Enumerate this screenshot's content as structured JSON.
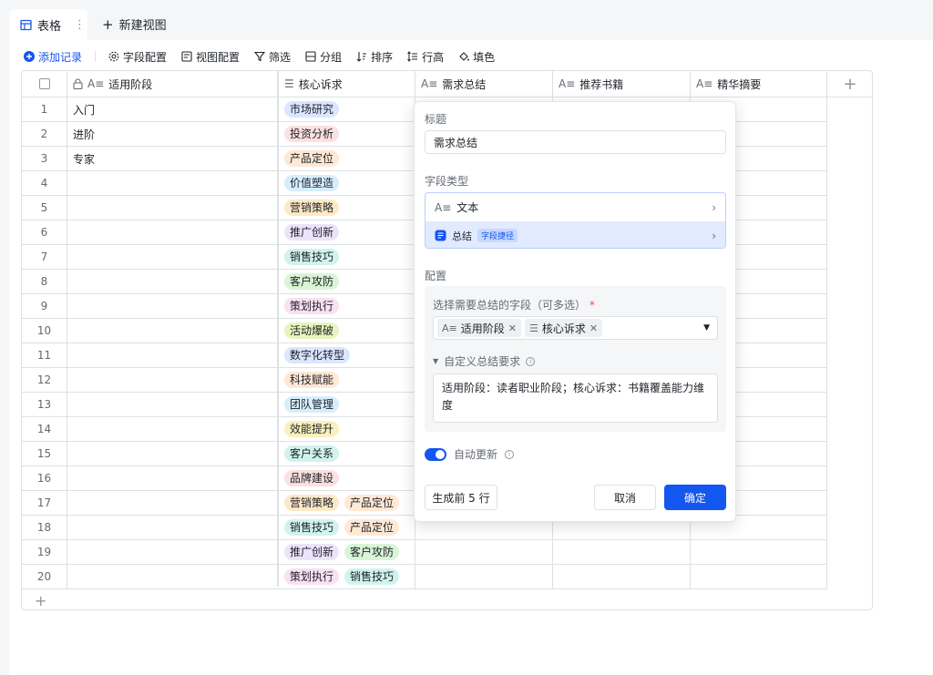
{
  "tabs": {
    "active": "表格",
    "new_view": "新建视图"
  },
  "toolbar": {
    "add_record": "添加记录",
    "field_config": "字段配置",
    "view_config": "视图配置",
    "filter": "筛选",
    "group": "分组",
    "sort": "排序",
    "row_height": "行高",
    "fill": "填色"
  },
  "columns": [
    "适用阶段",
    "核心诉求",
    "需求总结",
    "推荐书籍",
    "精华摘要"
  ],
  "rows": [
    {
      "n": "1",
      "stage": "入门",
      "tags": [
        {
          "t": "市场研究",
          "c": "#dbe6ff"
        }
      ]
    },
    {
      "n": "2",
      "stage": "进阶",
      "tags": [
        {
          "t": "投资分析",
          "c": "#fde0e0"
        }
      ]
    },
    {
      "n": "3",
      "stage": "专家",
      "tags": [
        {
          "t": "产品定位",
          "c": "#ffe8d4"
        }
      ]
    },
    {
      "n": "4",
      "stage": "",
      "tags": [
        {
          "t": "价值塑造",
          "c": "#d6eefc"
        }
      ]
    },
    {
      "n": "5",
      "stage": "",
      "tags": [
        {
          "t": "营销策略",
          "c": "#fde9c8"
        }
      ]
    },
    {
      "n": "6",
      "stage": "",
      "tags": [
        {
          "t": "推广创新",
          "c": "#ece3fb"
        }
      ]
    },
    {
      "n": "7",
      "stage": "",
      "tags": [
        {
          "t": "销售技巧",
          "c": "#d1f3ec"
        }
      ]
    },
    {
      "n": "8",
      "stage": "",
      "tags": [
        {
          "t": "客户攻防",
          "c": "#d9f5d6"
        }
      ]
    },
    {
      "n": "9",
      "stage": "",
      "tags": [
        {
          "t": "策划执行",
          "c": "#f9e0f2"
        }
      ]
    },
    {
      "n": "10",
      "stage": "",
      "tags": [
        {
          "t": "活动爆破",
          "c": "#e8f5bd"
        }
      ]
    },
    {
      "n": "11",
      "stage": "",
      "tags": [
        {
          "t": "数字化转型",
          "c": "#dbe6ff"
        }
      ]
    },
    {
      "n": "12",
      "stage": "",
      "tags": [
        {
          "t": "科技赋能",
          "c": "#ffe8d4"
        }
      ]
    },
    {
      "n": "13",
      "stage": "",
      "tags": [
        {
          "t": "团队管理",
          "c": "#d6eefc"
        }
      ]
    },
    {
      "n": "14",
      "stage": "",
      "tags": [
        {
          "t": "效能提升",
          "c": "#faf0bd"
        }
      ]
    },
    {
      "n": "15",
      "stage": "",
      "tags": [
        {
          "t": "客户关系",
          "c": "#d1f3ec"
        }
      ]
    },
    {
      "n": "16",
      "stage": "",
      "tags": [
        {
          "t": "品牌建设",
          "c": "#fde0e0"
        }
      ]
    },
    {
      "n": "17",
      "stage": "",
      "tags": [
        {
          "t": "营销策略",
          "c": "#fde9c8"
        },
        {
          "t": "产品定位",
          "c": "#ffe8d4"
        }
      ]
    },
    {
      "n": "18",
      "stage": "",
      "tags": [
        {
          "t": "销售技巧",
          "c": "#d1f3ec"
        },
        {
          "t": "产品定位",
          "c": "#ffe8d4"
        }
      ]
    },
    {
      "n": "19",
      "stage": "",
      "tags": [
        {
          "t": "推广创新",
          "c": "#ece3fb"
        },
        {
          "t": "客户攻防",
          "c": "#d9f5d6"
        }
      ]
    },
    {
      "n": "20",
      "stage": "",
      "tags": [
        {
          "t": "策划执行",
          "c": "#f9e0f2"
        },
        {
          "t": "销售技巧",
          "c": "#d1f3ec"
        }
      ]
    }
  ],
  "panel": {
    "title_label": "标题",
    "title_value": "需求总结",
    "field_type_label": "字段类型",
    "type_text": "文本",
    "type_summary": "总结",
    "type_summary_badge": "字段捷径",
    "config_label": "配置",
    "select_fields_label": "选择需要总结的字段（可多选）",
    "required_mark": "*",
    "chips": [
      "适用阶段",
      "核心诉求"
    ],
    "custom_label": "自定义总结要求",
    "custom_text": "适用阶段：读者职业阶段；核心诉求：书籍覆盖能力维度",
    "auto_update": "自动更新",
    "gen_button": "生成前 5 行",
    "cancel_button": "取消",
    "ok_button": "确定"
  },
  "colors": {
    "accent": "#1456f0",
    "border": "#dee0e3"
  }
}
